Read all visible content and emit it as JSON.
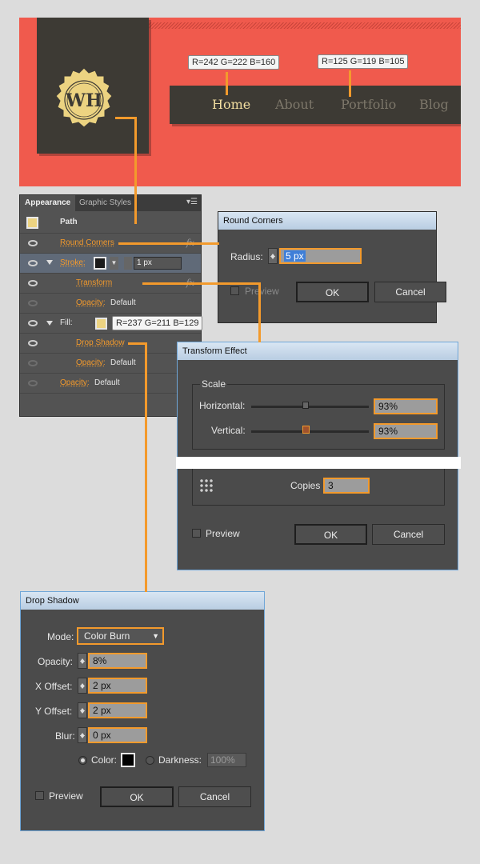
{
  "banner": {
    "logo_text": "WH",
    "nav": [
      "Home",
      "About",
      "Portfolio",
      "Blog"
    ],
    "callout_home": "R=242 G=222 B=160",
    "callout_nav": "R=125 G=119 B=105"
  },
  "appearance": {
    "tabs": [
      "Appearance",
      "Graphic Styles"
    ],
    "path_label": "Path",
    "round_corners": "Round Corners",
    "stroke_label": "Stroke:",
    "stroke_weight": "1 px",
    "transform": "Transform",
    "opacity_label": "Opacity:",
    "opacity_value": "Default",
    "fill_label": "Fill:",
    "fill_callout": "R=237 G=211 B=129",
    "drop_shadow": "Drop Shadow",
    "fx_symbol": "fx"
  },
  "round_corners": {
    "title": "Round Corners",
    "radius_label": "Radius:",
    "radius_value": "5 px",
    "preview": "Preview",
    "ok": "OK",
    "cancel": "Cancel"
  },
  "transform_effect": {
    "title": "Transform Effect",
    "scale_label": "Scale",
    "horizontal_label": "Horizontal:",
    "horizontal_value": "93%",
    "vertical_label": "Vertical:",
    "vertical_value": "93%",
    "copies_label": "Copies",
    "copies_value": "3",
    "preview": "Preview",
    "ok": "OK",
    "cancel": "Cancel"
  },
  "drop_shadow": {
    "title": "Drop Shadow",
    "mode_label": "Mode:",
    "mode_value": "Color Burn",
    "opacity_label": "Opacity:",
    "opacity_value": "8%",
    "x_label": "X Offset:",
    "x_value": "2 px",
    "y_label": "Y Offset:",
    "y_value": "2 px",
    "blur_label": "Blur:",
    "blur_value": "0 px",
    "color_label": "Color:",
    "darkness_label": "Darkness:",
    "darkness_value": "100%",
    "preview": "Preview",
    "ok": "OK",
    "cancel": "Cancel"
  },
  "colors": {
    "banner": "#f05a4d",
    "dark": "#3d3a34",
    "badge": "#ecd381",
    "accent": "#f39a2c",
    "nav_active": "#f2dea0",
    "nav_inactive": "#7d7769"
  }
}
